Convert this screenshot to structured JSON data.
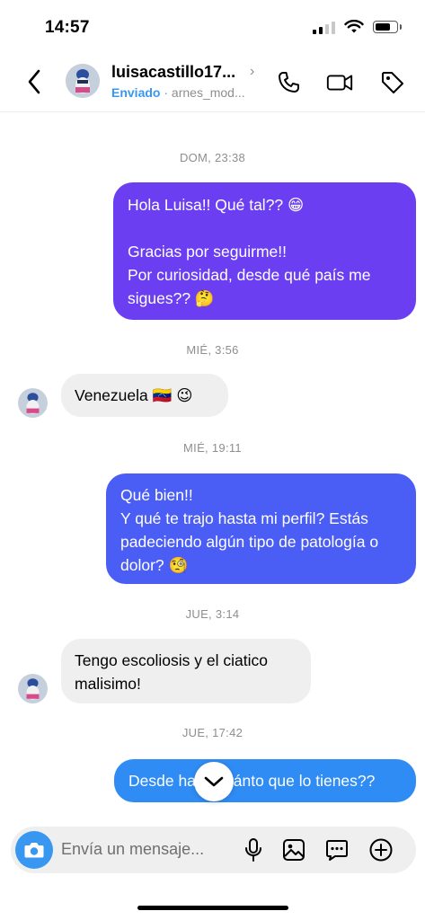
{
  "status_bar": {
    "time": "14:57"
  },
  "header": {
    "username": "luisacastillo17...",
    "status": "Enviado",
    "separator": "·",
    "secondary": "arnes_mod..."
  },
  "conversation": [
    {
      "type": "timestamp",
      "text": "DOM, 23:38"
    },
    {
      "type": "outgoing",
      "text": "Hola Luisa!! Qué tal?? 😁\n\nGracias por seguirme!!\nPor curiosidad, desde qué país me sigues?? 🤔",
      "color": "#6b3ff1"
    },
    {
      "type": "timestamp",
      "text": "MIÉ, 3:56"
    },
    {
      "type": "incoming",
      "text": "Venezuela 🇻🇪 😉"
    },
    {
      "type": "timestamp",
      "text": "MIÉ, 19:11"
    },
    {
      "type": "outgoing",
      "text": "Qué bien!!\nY qué te trajo hasta mi perfil? Estás padeciendo algún tipo de patología o dolor? 🧐",
      "color": "#4a5df5"
    },
    {
      "type": "timestamp",
      "text": "JUE, 3:14"
    },
    {
      "type": "incoming",
      "text": "Tengo escoliosis y el ciatico malisimo!"
    },
    {
      "type": "timestamp",
      "text": "JUE, 17:42"
    },
    {
      "type": "outgoing",
      "text": "Desde hace cuánto que lo tienes??",
      "color": "#2f8cf5"
    }
  ],
  "composer": {
    "placeholder": "Envía un mensaje..."
  },
  "icons": {
    "back": "chevron-left-icon",
    "call": "phone-icon",
    "video": "video-camera-icon",
    "tag": "tag-icon",
    "camera": "camera-icon",
    "mic": "microphone-icon",
    "gallery": "image-icon",
    "sticker": "chat-bubble-icon",
    "add": "plus-circle-icon",
    "scroll": "chevron-down-icon"
  }
}
